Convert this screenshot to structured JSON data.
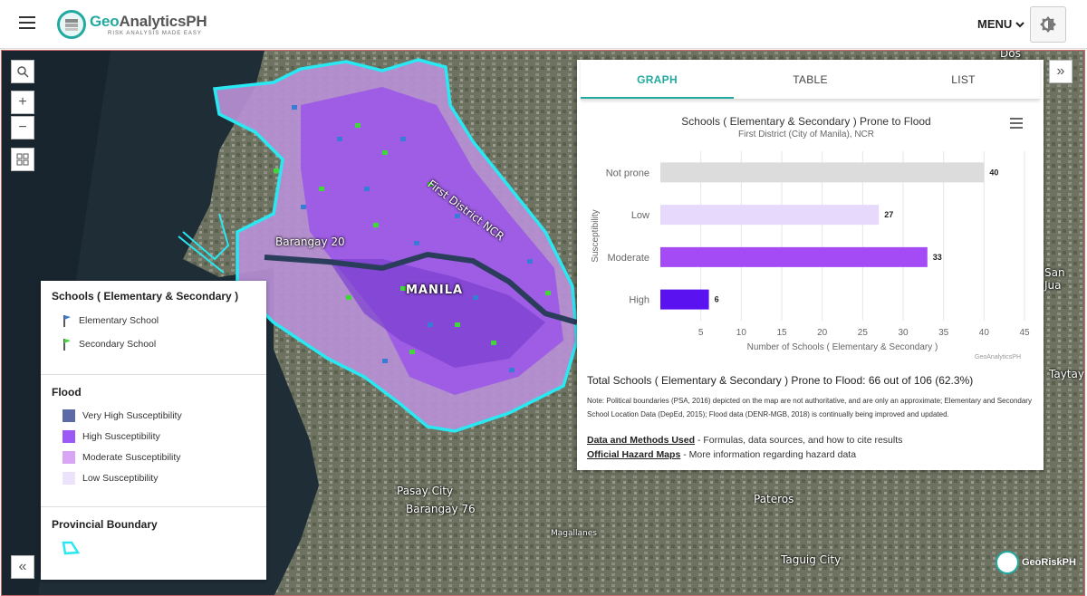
{
  "header": {
    "brand_prefix": "Geo",
    "brand_suffix": "AnalyticsPH",
    "tagline": "RISK ANALYSIS MADE EASY",
    "menu_label": "MENU"
  },
  "map": {
    "labels": {
      "barangay20": "Barangay 20",
      "manila": "MANILA",
      "first_district": "First District NCR",
      "pasay": "Pasay City",
      "barangay76": "Barangay 76",
      "pateros": "Pateros",
      "taguig": "Taguig City",
      "magallanes": "Magallanes",
      "san_juan": "San Jua",
      "taytay": "Taytay",
      "dos": "Dos"
    },
    "watermark": "GeoRiskPH"
  },
  "legend": {
    "schools_title": "Schools ( Elementary & Secondary )",
    "elementary": "Elementary School",
    "secondary": "Secondary School",
    "flood_title": "Flood",
    "flood_items": [
      {
        "label": "Very High Susceptibility",
        "color": "#5c6aa6"
      },
      {
        "label": "High Susceptibility",
        "color": "#9b59f5"
      },
      {
        "label": "Moderate Susceptibility",
        "color": "#d8a6f5"
      },
      {
        "label": "Low Susceptibility",
        "color": "#ece2fb"
      }
    ],
    "boundary_title": "Provincial Boundary",
    "icon_colors": {
      "elementary": "#3a7bd5",
      "secondary": "#43d63a",
      "boundary": "#29e8f2"
    }
  },
  "panel": {
    "tabs": [
      "GRAPH",
      "TABLE",
      "LIST"
    ],
    "active_tab": "GRAPH",
    "total_text": "Total Schools ( Elementary & Secondary ) Prone to Flood: 66 out of 106 (62.3%)",
    "note": "Note: Political boundaries (PSA, 2016) depicted on the map are not authoritative, and are only an approximate; Elementary and Secondary School Location Data (DepEd, 2015); Flood data (DENR-MGB, 2018) is continually being improved and updated.",
    "link1": "Data and Methods Used",
    "link1_rest": " - Formulas, data sources, and how to cite results",
    "link2": "Official Hazard Maps",
    "link2_rest": " - More information regarding hazard data"
  },
  "chart_data": {
    "type": "bar",
    "orientation": "horizontal",
    "title": "Schools ( Elementary & Secondary ) Prone to Flood",
    "subtitle": "First District (City of Manila), NCR",
    "categories": [
      "Not prone",
      "Low",
      "Moderate",
      "High"
    ],
    "values": [
      40,
      27,
      33,
      6
    ],
    "colors": [
      "#dcdcdc",
      "#e6d9fb",
      "#a44bf6",
      "#5a12f0"
    ],
    "xlabel": "Number of Schools ( Elementary & Secondary )",
    "ylabel": "Susceptibility",
    "xticks": [
      5,
      10,
      15,
      20,
      25,
      30,
      35,
      40,
      45
    ],
    "xlim": [
      0,
      45
    ],
    "credit": "GeoAnalyticsPH",
    "grid": true
  }
}
